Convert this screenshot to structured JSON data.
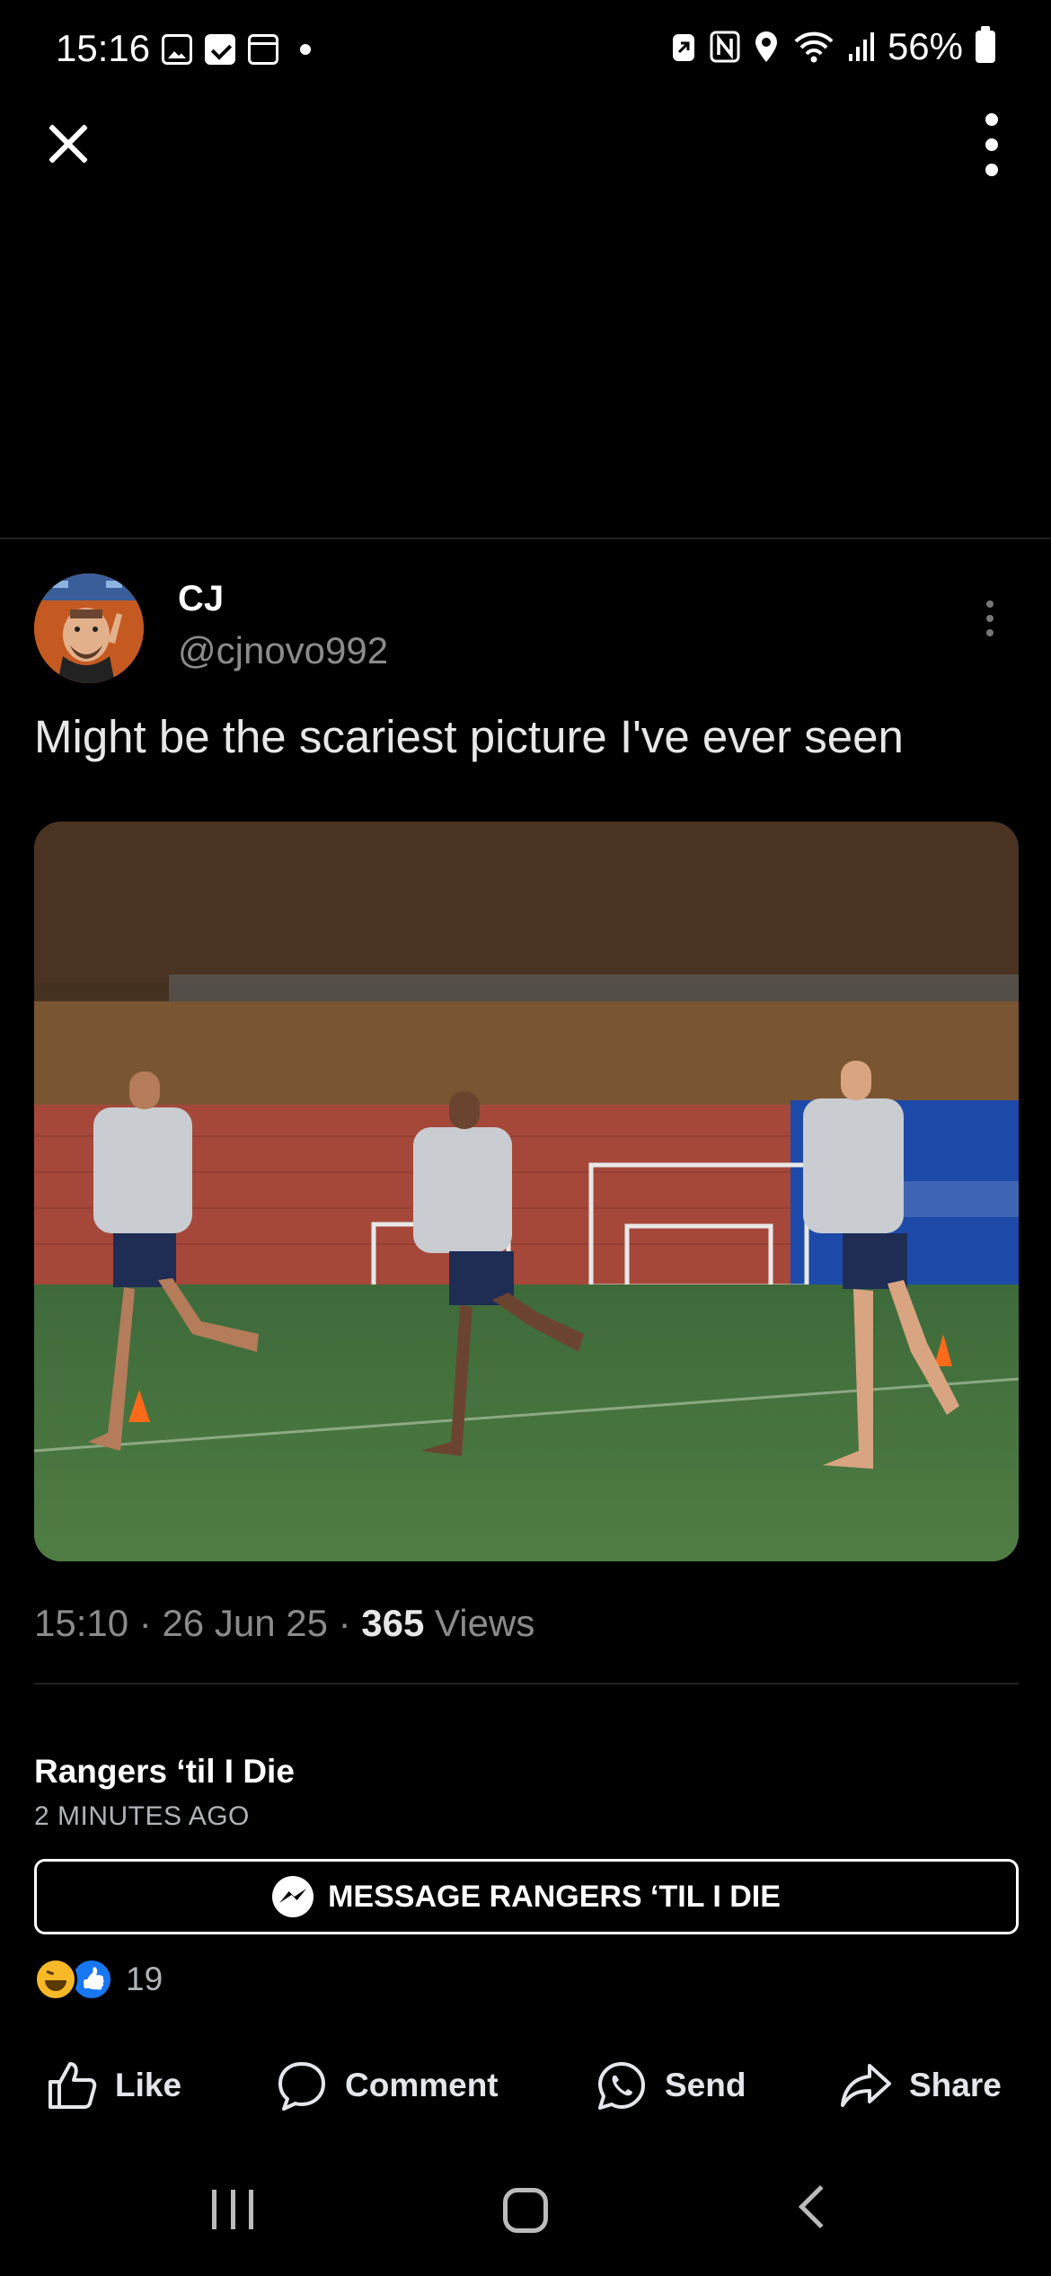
{
  "status_bar": {
    "time": "15:16",
    "battery": "56%",
    "left_icons": [
      "gallery-icon",
      "check-icon",
      "calendar-icon",
      "dot-icon"
    ],
    "right_icons": [
      "battery-saver-icon",
      "nfc-icon",
      "location-icon",
      "wifi-icon",
      "signal-icon"
    ]
  },
  "tweet": {
    "display_name": "CJ",
    "handle": "@cjnovo992",
    "text": "Might be the scariest picture I've ever seen",
    "time": "15:10",
    "date": "26 Jun 25",
    "views_count": "365",
    "views_label": "Views",
    "separator": "·"
  },
  "post": {
    "page_name": "Rangers ‘til I Die",
    "time_ago": "2 MINUTES AGO",
    "message_button": "MESSAGE RANGERS ‘TIL I DIE",
    "reaction_count": "19"
  },
  "actions": {
    "like": "Like",
    "comment": "Comment",
    "send": "Send",
    "share": "Share"
  },
  "colors": {
    "background": "#000000",
    "text_secondary": "#8b8b8b",
    "facebook_blue": "#1877f2",
    "haha_yellow": "#f7b928"
  }
}
